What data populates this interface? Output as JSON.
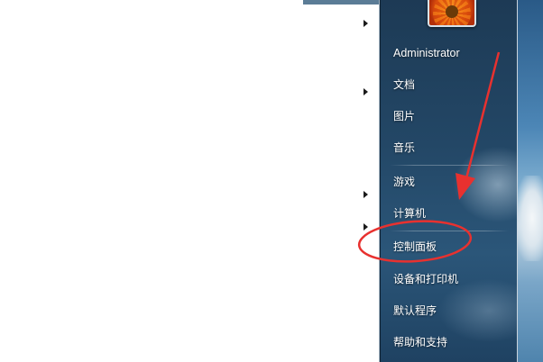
{
  "start_menu": {
    "user": {
      "name": "Administrator",
      "avatar": "flower-avatar-icon"
    },
    "right_items": [
      {
        "label": "文档"
      },
      {
        "label": "图片"
      },
      {
        "label": "音乐"
      },
      {
        "label": "游戏"
      },
      {
        "label": "计算机"
      },
      {
        "label": "控制面板"
      },
      {
        "label": "设备和打印机"
      },
      {
        "label": "默认程序"
      },
      {
        "label": "帮助和支持"
      }
    ]
  },
  "annotation": {
    "color": "#e8312f",
    "highlighted_item": "控制面板"
  }
}
